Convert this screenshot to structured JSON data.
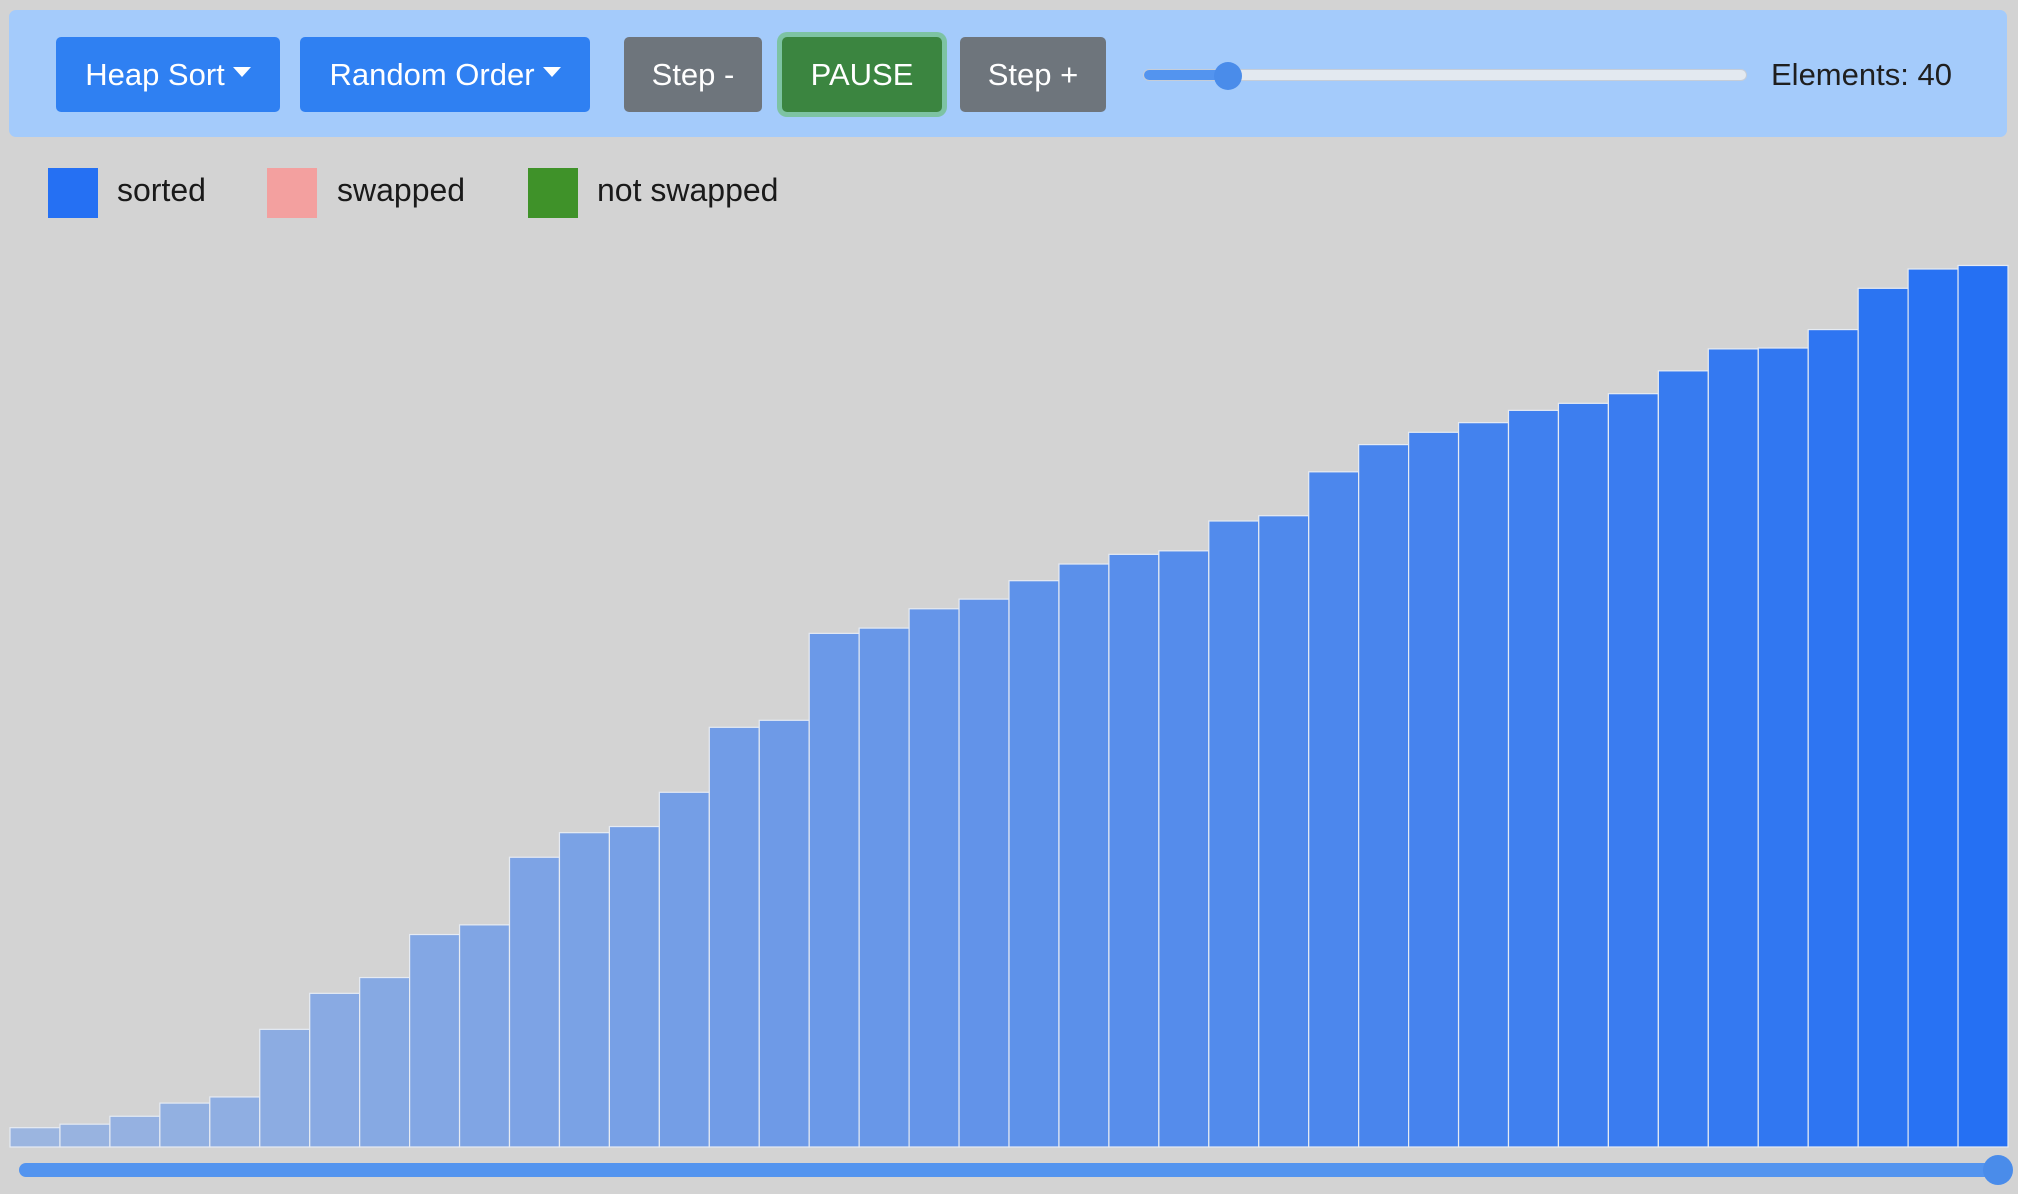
{
  "toolbar": {
    "algorithm_label": "Heap Sort",
    "order_label": "Random Order",
    "step_back_label": "Step -",
    "pause_label": "PAUSE",
    "step_forward_label": "Step +",
    "speed_fraction": 0.14,
    "elements_text": "Elements: 40"
  },
  "legend": {
    "items": [
      {
        "label": "sorted",
        "color": "#2570f3"
      },
      {
        "label": "swapped",
        "color": "#f3a09f"
      },
      {
        "label": "not swapped",
        "color": "#3f9229"
      }
    ]
  },
  "colors": {
    "bar_light": "#9bb5e0",
    "bar_dark": "#2570f3",
    "bar_border": "#e6ebf3"
  },
  "chart_data": {
    "type": "bar",
    "title": "",
    "xlabel": "",
    "ylabel": "",
    "ylim": [
      0,
      100
    ],
    "values": [
      2.2,
      2.6,
      3.5,
      5.0,
      5.7,
      13.4,
      17.5,
      19.3,
      24.2,
      25.3,
      33.0,
      35.8,
      36.5,
      40.4,
      47.8,
      48.6,
      58.5,
      59.1,
      61.3,
      62.4,
      64.5,
      66.4,
      67.5,
      67.9,
      71.3,
      71.9,
      76.9,
      80.0,
      81.4,
      82.5,
      83.9,
      84.7,
      85.8,
      88.4,
      90.9,
      91.0,
      93.1,
      97.8,
      100.0,
      100.4
    ]
  },
  "progress": {
    "fraction": 1.0
  }
}
